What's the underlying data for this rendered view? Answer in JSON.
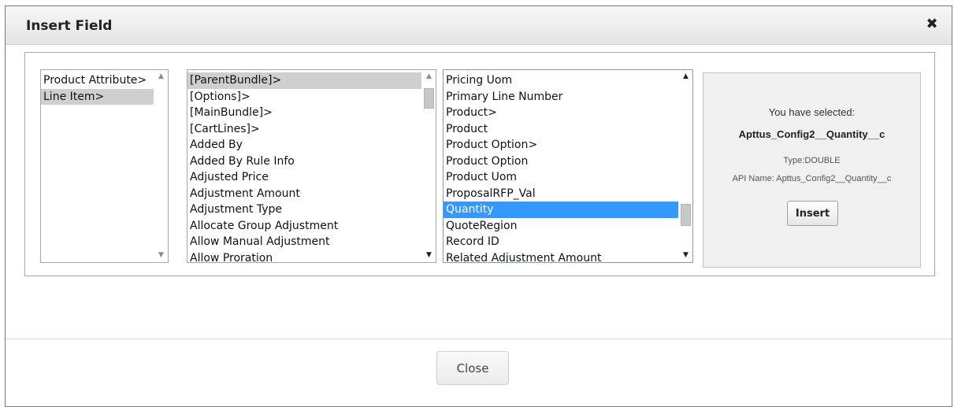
{
  "dialog": {
    "title": "Insert Field",
    "close_icon": "close-x-icon",
    "close_glyph": "✖"
  },
  "lists": {
    "objects": {
      "items": [
        "Product Attribute>",
        "Line Item>"
      ],
      "selected_index": 1
    },
    "related": {
      "items": [
        "[ParentBundle]>",
        "[Options]>",
        "[MainBundle]>",
        "[CartLines]>",
        "Added By",
        "Added By Rule Info",
        "Adjusted Price",
        "Adjustment Amount",
        "Adjustment Type",
        "Allocate Group Adjustment",
        "Allow Manual Adjustment",
        "Allow Proration"
      ],
      "selected_index": 0
    },
    "fields": {
      "items": [
        "Pricing Uom",
        "Primary Line Number",
        "Product>",
        "Product",
        "Product Option>",
        "Product Option",
        "Product Uom",
        "ProposalRFP_Val",
        "Quantity",
        "QuoteRegion",
        "Record ID",
        "Related Adjustment Amount"
      ],
      "selected_index": 8
    }
  },
  "selection": {
    "label": "You have selected:",
    "field_name": "Apttus_Config2__Quantity__c",
    "type_text": "Type:DOUBLE",
    "api_text": "API Name: Apttus_Config2__Quantity__c",
    "insert_label": "Insert"
  },
  "footer": {
    "close_label": "Close"
  },
  "colors": {
    "selected_blue": "#3399ff",
    "selected_gray": "#cfcfcf"
  }
}
